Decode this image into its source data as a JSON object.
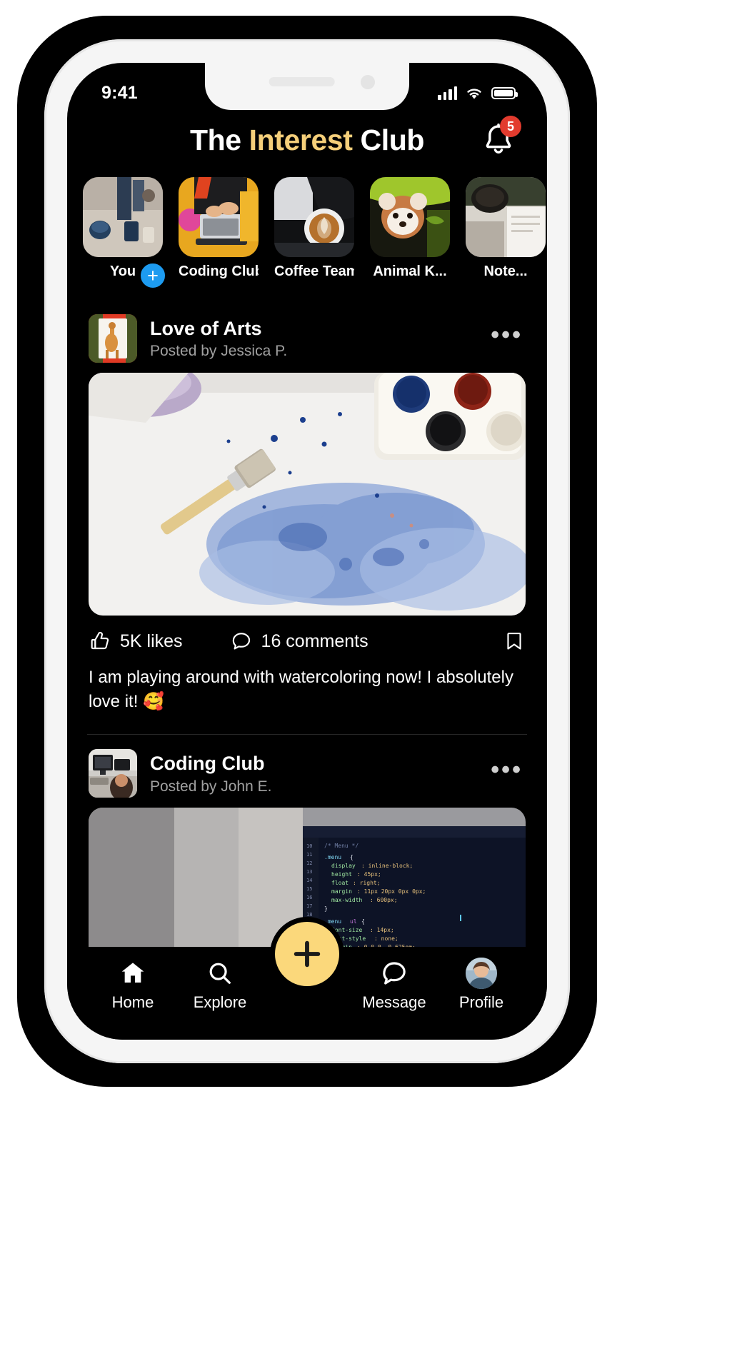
{
  "status_bar": {
    "time": "9:41",
    "signal_icon": "cellular-signal-icon",
    "wifi_icon": "wifi-icon",
    "battery_icon": "battery-full-icon"
  },
  "header": {
    "title_part1": "The ",
    "title_accent": "Interest",
    "title_part2": " Club",
    "accent_color": "#f5cf7a",
    "bell_icon": "bell-icon",
    "notification_count": "5",
    "badge_color": "#e23b2e"
  },
  "stories": [
    {
      "label": "You",
      "has_add_badge": true,
      "thumb": "coffee-table-scene"
    },
    {
      "label": "Coding Club",
      "has_add_badge": false,
      "thumb": "laptop-coding"
    },
    {
      "label": "Coffee Team",
      "has_add_badge": false,
      "thumb": "latte-pour"
    },
    {
      "label": "Animal K...",
      "has_add_badge": false,
      "thumb": "red-panda"
    },
    {
      "label": "Note...",
      "has_add_badge": false,
      "thumb": "coffee-cup-notes"
    }
  ],
  "posts": [
    {
      "club": "Love of Arts",
      "author": "Posted by Jessica P.",
      "avatar": "giraffe-painting-thumb",
      "media": "watercolor-painting-flatlay",
      "more_icon": "more-options-icon",
      "likes_icon": "thumbs-up-icon",
      "likes": "5K likes",
      "comments_icon": "comment-bubble-icon",
      "comments": "16 comments",
      "save_icon": "bookmark-icon",
      "caption": "I am playing around with watercoloring now! I absolutely love it! 🥰"
    },
    {
      "club": "Coding Club",
      "author": "Posted by John E.",
      "avatar": "desk-workstation-thumb",
      "media": "code-editor-screen",
      "more_icon": "more-options-icon"
    }
  ],
  "bottom_nav": {
    "items": [
      {
        "label": "Home",
        "icon": "home-icon"
      },
      {
        "label": "Explore",
        "icon": "search-icon"
      },
      {
        "label": "Message",
        "icon": "message-bubble-icon"
      },
      {
        "label": "Profile",
        "icon": "profile-avatar-icon"
      }
    ],
    "fab": {
      "icon": "plus-icon",
      "label": "+",
      "color": "#fbd87b"
    }
  }
}
